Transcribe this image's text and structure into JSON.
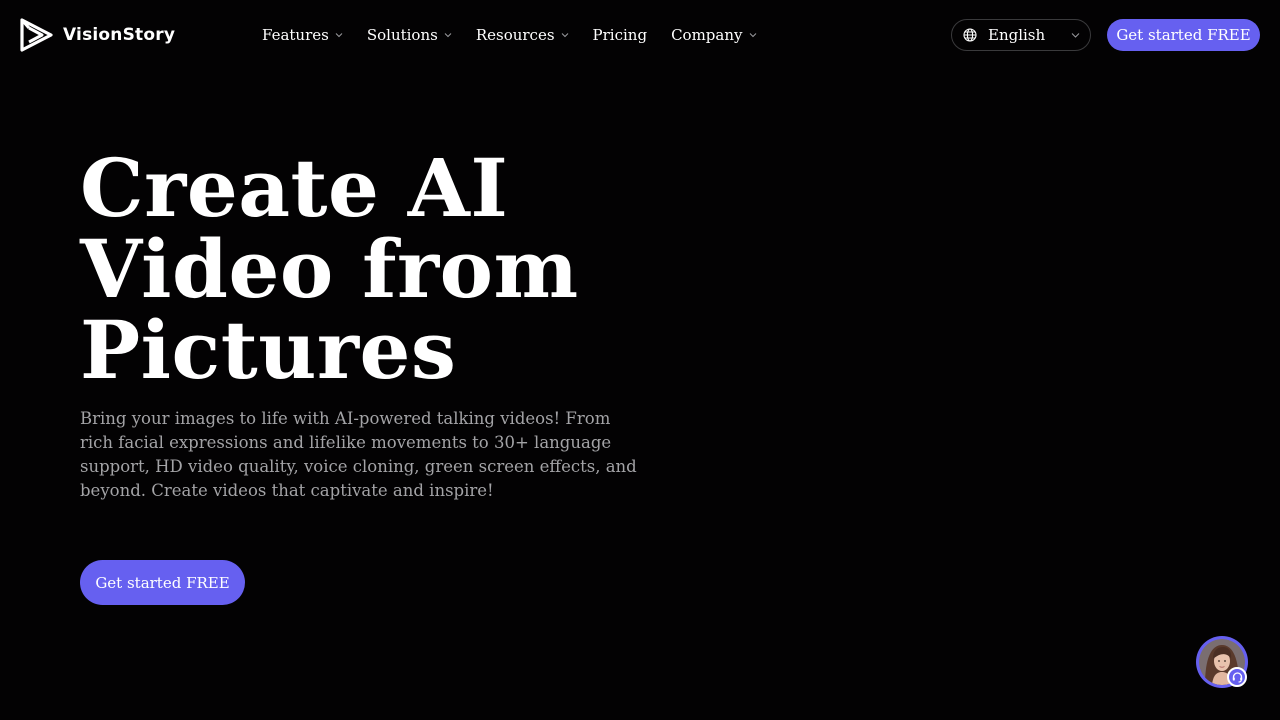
{
  "brand": {
    "name": "VisionStory",
    "logo_icon": "play-triangle-logo",
    "accent_color": "#6660f0"
  },
  "nav": {
    "items": [
      {
        "label": "Features",
        "has_dropdown": true
      },
      {
        "label": "Solutions",
        "has_dropdown": true
      },
      {
        "label": "Resources",
        "has_dropdown": true
      },
      {
        "label": "Pricing",
        "has_dropdown": false
      },
      {
        "label": "Company",
        "has_dropdown": true
      }
    ]
  },
  "language": {
    "icon": "globe-icon",
    "selected": "English"
  },
  "header_cta": {
    "label": "Get started FREE"
  },
  "hero": {
    "title_lines": [
      "Create AI",
      "Video from",
      "Pictures"
    ],
    "description": "Bring your images to life with AI-powered talking videos! From rich facial expressions and lifelike movements to 30+ language support, HD video quality, voice cloning, green screen effects, and beyond. Create videos that captivate and inspire!",
    "cta_label": "Get started FREE"
  },
  "support_widget": {
    "icon": "headset-icon",
    "avatar": "support-avatar"
  }
}
